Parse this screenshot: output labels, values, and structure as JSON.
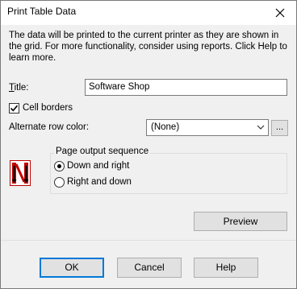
{
  "window": {
    "title": "Print Table Data"
  },
  "description": "The data will be printed to the current printer as they are shown in the grid. For more functionality, consider using reports. Click Help to learn more.",
  "title_field": {
    "label": "Title:",
    "value": "Software Shop"
  },
  "cell_borders": {
    "label": "Cell borders",
    "checked": true
  },
  "alt_row_color": {
    "label": "Alternate row color:",
    "value": "(None)",
    "browse_label": "..."
  },
  "page_sequence": {
    "caption": "Page output sequence",
    "options": [
      {
        "label": "Down and right",
        "selected": true
      },
      {
        "label": "Right and down",
        "selected": false
      }
    ]
  },
  "buttons": {
    "preview": "Preview",
    "ok": "OK",
    "cancel": "Cancel",
    "help": "Help"
  },
  "colors": {
    "icon_red": "#c00000",
    "focus_blue": "#0078d7"
  }
}
